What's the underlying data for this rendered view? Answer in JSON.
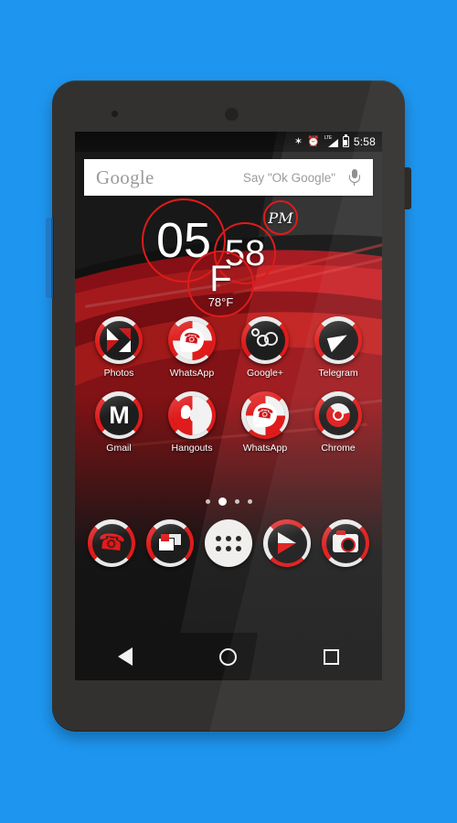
{
  "theme": {
    "background_color": "#1e96f0",
    "accent_red": "#e01b1b",
    "device_body": "#33312f",
    "screen_dark": "#1b1b1b"
  },
  "status_bar": {
    "bluetooth_icon": "bluetooth-icon",
    "alarm_icon": "alarm-icon",
    "network_label": "LTE",
    "signal_icon": "signal-icon",
    "battery_icon": "battery-icon",
    "time": "5:58"
  },
  "search": {
    "logo": "Google",
    "hint": "Say \"Ok Google\"",
    "mic_icon": "microphone-icon"
  },
  "clock_widget": {
    "hours": "05",
    "minutes": "58",
    "ampm": "PM",
    "weather_symbol": "F",
    "temperature": "78°F"
  },
  "app_grid": {
    "rows": [
      [
        {
          "label": "Photos",
          "icon": "photos-icon"
        },
        {
          "label": "WhatsApp",
          "icon": "whatsapp-icon"
        },
        {
          "label": "Google+",
          "icon": "google-plus-icon"
        },
        {
          "label": "Telegram",
          "icon": "telegram-icon"
        }
      ],
      [
        {
          "label": "Gmail",
          "icon": "gmail-icon"
        },
        {
          "label": "Hangouts",
          "icon": "hangouts-icon"
        },
        {
          "label": "WhatsApp",
          "icon": "whatsapp-icon"
        },
        {
          "label": "Chrome",
          "icon": "chrome-icon"
        }
      ]
    ]
  },
  "page_indicator": {
    "total": 4,
    "active_index": 1
  },
  "dock": {
    "items": [
      {
        "name": "phone",
        "icon": "phone-icon"
      },
      {
        "name": "messages",
        "icon": "messages-icon"
      },
      {
        "name": "app-drawer",
        "icon": "apps-grid-icon"
      },
      {
        "name": "play-store",
        "icon": "play-store-icon"
      },
      {
        "name": "camera",
        "icon": "camera-icon"
      }
    ]
  },
  "nav_bar": {
    "back": "back-triangle-icon",
    "home": "home-circle-icon",
    "recents": "recents-square-icon"
  },
  "device": {
    "power_button": "power-button",
    "volume_button": "volume-rocker-button",
    "front_camera": "front-camera",
    "proximity_sensor": "proximity-sensor"
  }
}
